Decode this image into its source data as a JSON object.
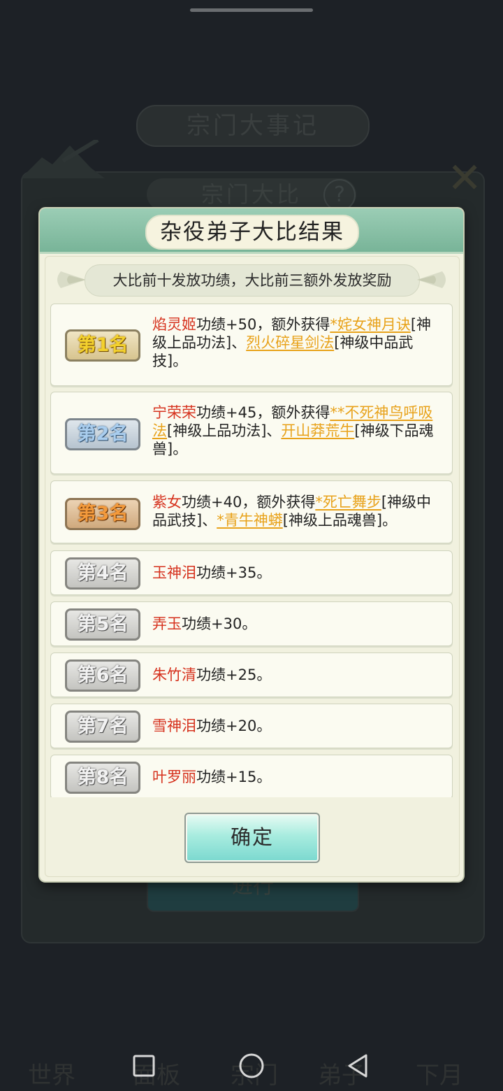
{
  "background": {
    "header_title": "宗门大事记",
    "sub_title": "宗门大比",
    "help_icon": "question-icon",
    "go_button_label": "进行",
    "tabs": [
      "世界",
      "面板",
      "宗门",
      "弟子",
      "下月"
    ]
  },
  "dialog": {
    "title": "杂役弟子大比结果",
    "notice": "大比前十发放功绩，大比前三额外发放奖励",
    "confirm_label": "确定",
    "results": [
      {
        "rank": "第1名",
        "medal": "gold",
        "name": "焰灵姬",
        "merit": "功绩+50，额外获得",
        "reward1": "*姹女神月诀",
        "reward1_type": "[神级上品功法]、",
        "reward2": "烈火碎星剑法",
        "reward2_type": "[神级中品武技]。"
      },
      {
        "rank": "第2名",
        "medal": "blue",
        "name": "宁荣荣",
        "merit": "功绩+45，额外获得",
        "reward1": "**不死神鸟呼吸法",
        "reward1_type": "[神级上品功法]、",
        "reward2": "开山莽荒牛",
        "reward2_type": "[神级下品魂兽]。"
      },
      {
        "rank": "第3名",
        "medal": "bronze",
        "name": "紫女",
        "merit": "功绩+40，额外获得",
        "reward1": "*死亡舞步",
        "reward1_type": "[神级中品武技]、",
        "reward2": "*青牛神蟒",
        "reward2_type": "[神级上品魂兽]。"
      },
      {
        "rank": "第4名",
        "medal": "grey",
        "name": "玉神泪",
        "merit": "功绩+35。"
      },
      {
        "rank": "第5名",
        "medal": "grey",
        "name": "弄玉",
        "merit": "功绩+30。"
      },
      {
        "rank": "第6名",
        "medal": "grey",
        "name": "朱竹清",
        "merit": "功绩+25。"
      },
      {
        "rank": "第7名",
        "medal": "grey",
        "name": "雪神泪",
        "merit": "功绩+20。"
      },
      {
        "rank": "第8名",
        "medal": "grey",
        "name": "叶罗丽",
        "merit": "功绩+15。"
      }
    ]
  },
  "navbar": {
    "recent_icon": "square-icon",
    "home_icon": "circle-icon",
    "back_icon": "triangle-back-icon"
  },
  "colors": {
    "name_red": "#d6321e",
    "reward_gold": "#e8a21a",
    "dialog_header": "#78b498",
    "dialog_bg": "#f1f1df"
  }
}
